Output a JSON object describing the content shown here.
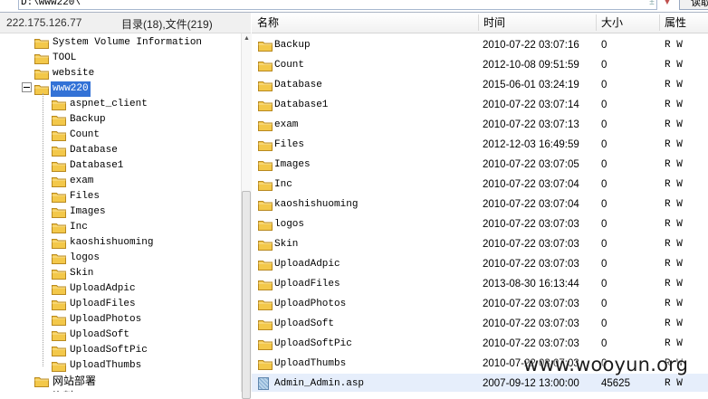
{
  "address": {
    "path": "D:\\www220\\",
    "read_button": "读取"
  },
  "info": {
    "ip": "222.175.126.77",
    "counts": "目录(18),文件(219)"
  },
  "tree": {
    "items": [
      {
        "label": "System Volume Information",
        "level": 1
      },
      {
        "label": "TOOL",
        "level": 1
      },
      {
        "label": "website",
        "level": 1
      },
      {
        "label": "www220",
        "level": 1,
        "selected": true,
        "expanded": true
      },
      {
        "label": "aspnet_client",
        "level": 2
      },
      {
        "label": "Backup",
        "level": 2
      },
      {
        "label": "Count",
        "level": 2
      },
      {
        "label": "Database",
        "level": 2
      },
      {
        "label": "Database1",
        "level": 2
      },
      {
        "label": "exam",
        "level": 2
      },
      {
        "label": "Files",
        "level": 2
      },
      {
        "label": "Images",
        "level": 2
      },
      {
        "label": "Inc",
        "level": 2
      },
      {
        "label": "kaoshishuoming",
        "level": 2
      },
      {
        "label": "logos",
        "level": 2
      },
      {
        "label": "Skin",
        "level": 2
      },
      {
        "label": "UploadAdpic",
        "level": 2
      },
      {
        "label": "UploadFiles",
        "level": 2
      },
      {
        "label": "UploadPhotos",
        "level": 2
      },
      {
        "label": "UploadSoft",
        "level": 2
      },
      {
        "label": "UploadSoftPic",
        "level": 2
      },
      {
        "label": "UploadThumbs",
        "level": 2
      },
      {
        "label": "网站部署",
        "level": 1
      },
      {
        "label": "资料",
        "level": 1
      }
    ]
  },
  "list": {
    "columns": {
      "name": "名称",
      "time": "时间",
      "size": "大小",
      "attr": "属性"
    },
    "rows": [
      {
        "name": "Backup",
        "time": "2010-07-22 03:07:16",
        "size": "0",
        "attr": "R W",
        "type": "folder"
      },
      {
        "name": "Count",
        "time": "2012-10-08 09:51:59",
        "size": "0",
        "attr": "R W",
        "type": "folder"
      },
      {
        "name": "Database",
        "time": "2015-06-01 03:24:19",
        "size": "0",
        "attr": "R W",
        "type": "folder"
      },
      {
        "name": "Database1",
        "time": "2010-07-22 03:07:14",
        "size": "0",
        "attr": "R W",
        "type": "folder"
      },
      {
        "name": "exam",
        "time": "2010-07-22 03:07:13",
        "size": "0",
        "attr": "R W",
        "type": "folder"
      },
      {
        "name": "Files",
        "time": "2012-12-03 16:49:59",
        "size": "0",
        "attr": "R W",
        "type": "folder"
      },
      {
        "name": "Images",
        "time": "2010-07-22 03:07:05",
        "size": "0",
        "attr": "R W",
        "type": "folder"
      },
      {
        "name": "Inc",
        "time": "2010-07-22 03:07:04",
        "size": "0",
        "attr": "R W",
        "type": "folder"
      },
      {
        "name": "kaoshishuoming",
        "time": "2010-07-22 03:07:04",
        "size": "0",
        "attr": "R W",
        "type": "folder"
      },
      {
        "name": "logos",
        "time": "2010-07-22 03:07:03",
        "size": "0",
        "attr": "R W",
        "type": "folder"
      },
      {
        "name": "Skin",
        "time": "2010-07-22 03:07:03",
        "size": "0",
        "attr": "R W",
        "type": "folder"
      },
      {
        "name": "UploadAdpic",
        "time": "2010-07-22 03:07:03",
        "size": "0",
        "attr": "R W",
        "type": "folder"
      },
      {
        "name": "UploadFiles",
        "time": "2013-08-30 16:13:44",
        "size": "0",
        "attr": "R W",
        "type": "folder"
      },
      {
        "name": "UploadPhotos",
        "time": "2010-07-22 03:07:03",
        "size": "0",
        "attr": "R W",
        "type": "folder"
      },
      {
        "name": "UploadSoft",
        "time": "2010-07-22 03:07:03",
        "size": "0",
        "attr": "R W",
        "type": "folder"
      },
      {
        "name": "UploadSoftPic",
        "time": "2010-07-22 03:07:03",
        "size": "0",
        "attr": "R W",
        "type": "folder"
      },
      {
        "name": "UploadThumbs",
        "time": "2010-07-22 03:07:03",
        "size": "0",
        "attr": "R W",
        "type": "folder"
      },
      {
        "name": "Admin_Admin.asp",
        "time": "2007-09-12 13:00:00",
        "size": "45625",
        "attr": "R W",
        "type": "file"
      }
    ]
  },
  "watermark": "www.wooyun.org",
  "colors": {
    "folder": "#f3c84a",
    "selection": "#3372d6",
    "file_row": "#e6eefb"
  },
  "icons": {
    "folder": "folder-icon",
    "file": "asp-file-icon",
    "collapse": "collapse-minus-icon",
    "dropdown": "chevron-down-icon"
  }
}
